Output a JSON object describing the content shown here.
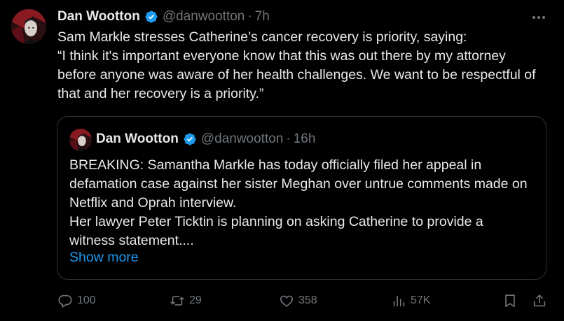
{
  "tweet": {
    "author_name": "Dan Wootton",
    "handle": "@danwootton",
    "separator": "·",
    "time": "7h",
    "text": "Sam Markle stresses Catherine’s cancer recovery is priority, saying:\n“I think it's important everyone know that this was out there by my attorney before anyone was aware of her health challenges. We want to be respectful of that and her recovery is a priority.”"
  },
  "quoted_tweet": {
    "author_name": "Dan Wootton",
    "handle": "@danwootton",
    "separator": "·",
    "time": "16h",
    "text": "BREAKING: Samantha Markle has today officially filed her appeal in defamation case against her sister Meghan over untrue comments made on Netflix and Oprah interview.\nHer lawyer Peter Ticktin is planning on asking Catherine to provide a witness statement....",
    "show_more_label": "Show more"
  },
  "actions": {
    "replies": "100",
    "reposts": "29",
    "likes": "358",
    "views": "57K"
  },
  "colors": {
    "background": "#000000",
    "text": "#e7e9ea",
    "muted": "#71767b",
    "accent": "#1d9bf0",
    "border": "#2f3336"
  },
  "icons": {
    "verified": "verified-badge-icon",
    "more": "more-dots-icon",
    "reply": "reply-icon",
    "repost": "repost-icon",
    "like": "heart-icon",
    "views": "views-chart-icon",
    "bookmark": "bookmark-icon",
    "share": "share-icon"
  }
}
